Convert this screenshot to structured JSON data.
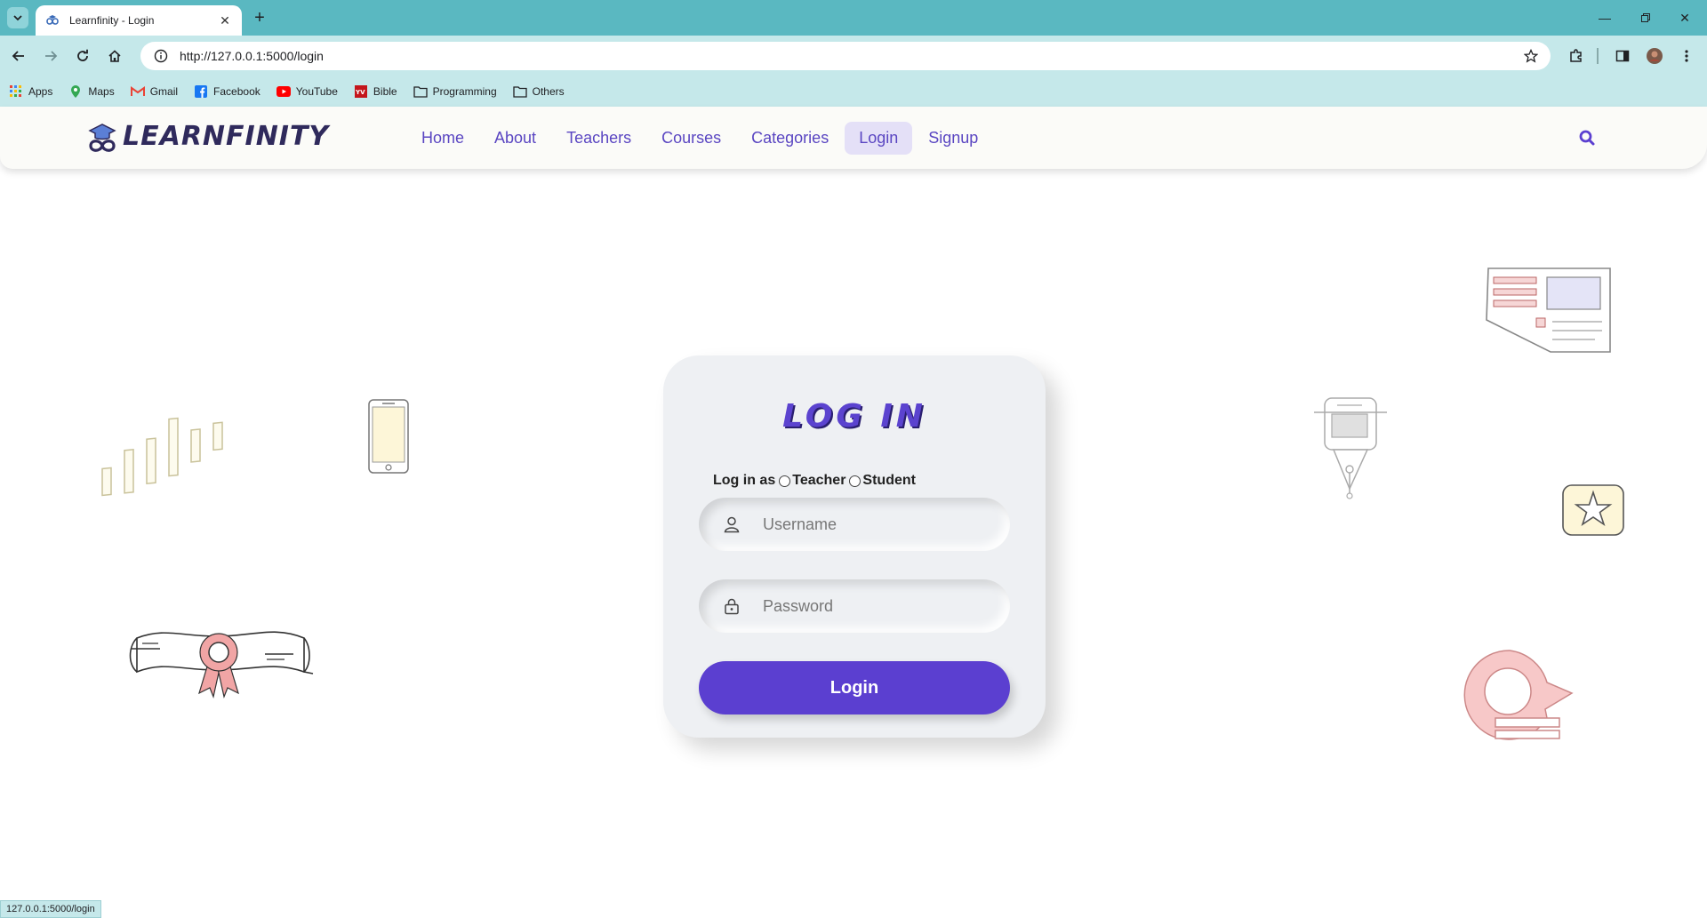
{
  "browser": {
    "tab_title": "Learnfinity - Login",
    "url": "http://127.0.0.1:5000/login",
    "bookmarks": [
      {
        "label": "Apps",
        "icon": "apps-grid-icon"
      },
      {
        "label": "Maps",
        "icon": "maps-pin-icon"
      },
      {
        "label": "Gmail",
        "icon": "gmail-icon"
      },
      {
        "label": "Facebook",
        "icon": "facebook-icon"
      },
      {
        "label": "YouTube",
        "icon": "youtube-icon"
      },
      {
        "label": "Bible",
        "icon": "bible-icon"
      },
      {
        "label": "Programming",
        "icon": "folder-icon"
      },
      {
        "label": "Others",
        "icon": "folder-icon"
      }
    ],
    "status_url": "127.0.0.1:5000/login"
  },
  "site": {
    "logo_text": "LEARNFINITY",
    "nav": [
      {
        "label": "Home"
      },
      {
        "label": "About"
      },
      {
        "label": "Teachers"
      },
      {
        "label": "Courses"
      },
      {
        "label": "Categories"
      },
      {
        "label": "Login",
        "active": true
      },
      {
        "label": "Signup"
      }
    ]
  },
  "login": {
    "title": "LOG IN",
    "role_prompt": "Log in as",
    "role_teacher": "Teacher",
    "role_student": "Student",
    "username_placeholder": "Username",
    "password_placeholder": "Password",
    "submit_label": "Login"
  },
  "colors": {
    "accent": "#5b3fd0",
    "nav_link": "#5a46c2",
    "browser_frame": "#5ab8c1",
    "card_bg": "#eef0f3"
  }
}
